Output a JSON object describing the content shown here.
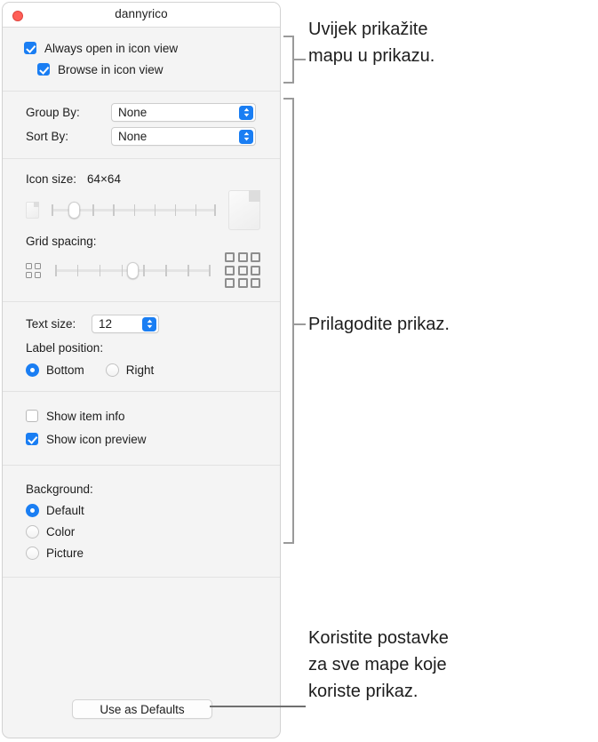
{
  "window": {
    "title": "dannyrico",
    "close_button": "close-icon"
  },
  "section_view": {
    "checkboxes": [
      {
        "label": "Always open in icon view",
        "checked": true
      },
      {
        "label": "Browse in icon view",
        "checked": true
      }
    ]
  },
  "section_arrange": {
    "rows": [
      {
        "label": "Group By:",
        "value": "None"
      },
      {
        "label": "Sort By:",
        "value": "None"
      }
    ]
  },
  "section_size": {
    "icon_size_label": "Icon size:",
    "icon_size_value": "64×64",
    "icon_size_slider": {
      "ticks": 9,
      "thumb_index": 1
    },
    "grid_spacing_label": "Grid spacing:",
    "grid_spacing_slider": {
      "ticks": 8,
      "thumb_index": 3
    }
  },
  "section_text": {
    "text_size_label": "Text size:",
    "text_size_value": "12",
    "label_position_label": "Label position:",
    "label_position_options": [
      {
        "label": "Bottom",
        "selected": true
      },
      {
        "label": "Right",
        "selected": false
      }
    ]
  },
  "section_show": {
    "checkboxes": [
      {
        "label": "Show item info",
        "checked": false
      },
      {
        "label": "Show icon preview",
        "checked": true
      }
    ]
  },
  "section_background": {
    "label": "Background:",
    "options": [
      {
        "label": "Default",
        "selected": true
      },
      {
        "label": "Color",
        "selected": false
      },
      {
        "label": "Picture",
        "selected": false
      }
    ]
  },
  "footer": {
    "use_as_defaults": "Use as Defaults"
  },
  "callouts": [
    {
      "text": "Uvijek prikažite\nmapu u prikazu."
    },
    {
      "text": "Prilagodite prikaz."
    },
    {
      "text": "Koristite postavke\nza sve mape koje\nkoriste prikaz."
    }
  ],
  "colors": {
    "accent": "#1a7ef3",
    "close": "#ff5f57",
    "window_bg": "#f4f4f4",
    "titlebar_bg": "#ffffff",
    "divider": "#e2e2e2",
    "callout_line": "#9a9a9a"
  }
}
